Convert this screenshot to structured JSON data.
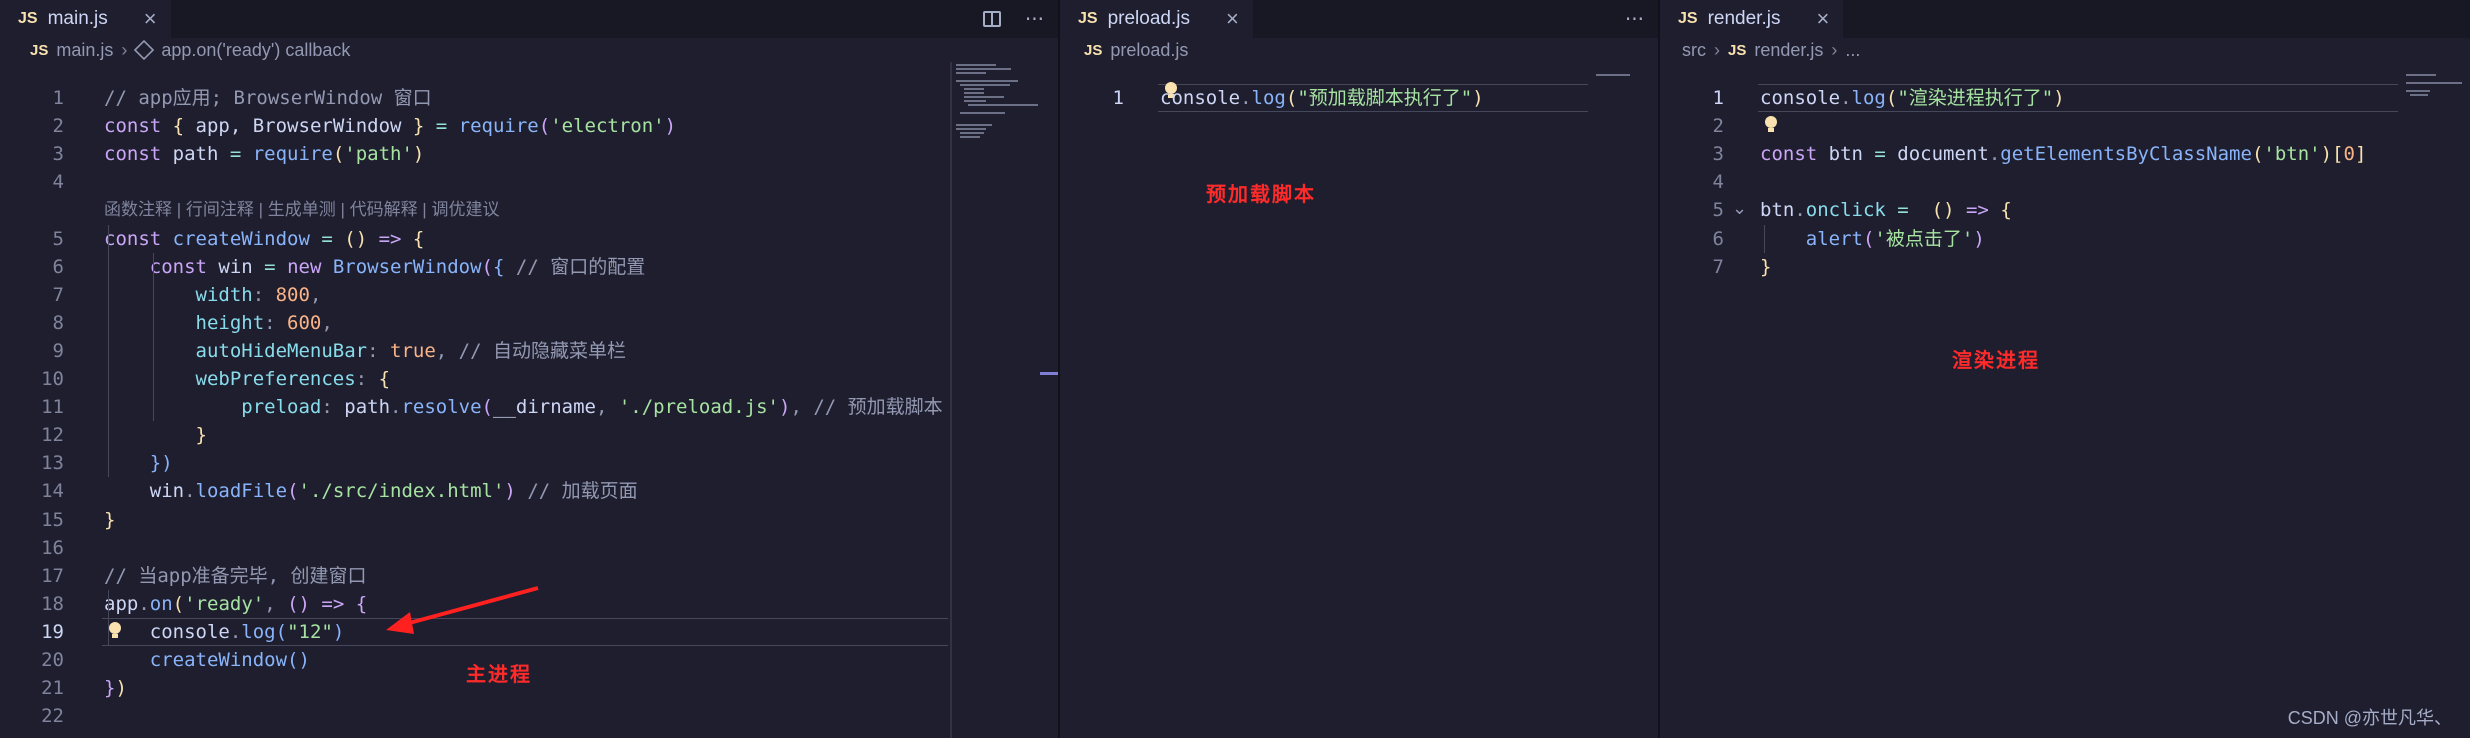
{
  "panes": {
    "main": {
      "tab": {
        "badge": "JS",
        "name": "main.js"
      },
      "breadcrumb": {
        "badge": "JS",
        "file": "main.js",
        "symbol": "app.on('ready') callback"
      },
      "codelens": "函数注释 | 行间注释 | 生成单测 | 代码解释 | 调优建议",
      "lines": [
        {
          "n": "1",
          "tokens": [
            [
              "cm",
              "// app应用; BrowserWindow 窗口"
            ]
          ]
        },
        {
          "n": "2",
          "tokens": [
            [
              "kw",
              "const"
            ],
            [
              "var",
              " "
            ],
            [
              "brk",
              "{"
            ],
            [
              "var",
              " app, BrowserWindow "
            ],
            [
              "brk",
              "}"
            ],
            [
              "op",
              " = "
            ],
            [
              "fn",
              "require"
            ],
            [
              "brk2",
              "("
            ],
            [
              "str",
              "'electron'"
            ],
            [
              "brk2",
              ")"
            ]
          ]
        },
        {
          "n": "3",
          "tokens": [
            [
              "kw",
              "const"
            ],
            [
              "var",
              " path "
            ],
            [
              "op",
              "= "
            ],
            [
              "fn",
              "require"
            ],
            [
              "brk",
              "("
            ],
            [
              "str",
              "'path'"
            ],
            [
              "brk",
              ")"
            ]
          ]
        },
        {
          "n": "4",
          "tokens": []
        },
        {
          "n": "5",
          "tokens": [
            [
              "kw",
              "const"
            ],
            [
              "fn",
              " createWindow"
            ],
            [
              "op",
              " = "
            ],
            [
              "brk",
              "()"
            ],
            [
              "kw",
              " =>"
            ],
            [
              "var",
              " "
            ],
            [
              "brk",
              "{"
            ]
          ]
        },
        {
          "n": "6",
          "tokens": [
            [
              "var",
              "    "
            ],
            [
              "kw",
              "const"
            ],
            [
              "var",
              " win "
            ],
            [
              "op",
              "= "
            ],
            [
              "kw",
              "new"
            ],
            [
              "fn",
              " BrowserWindow"
            ],
            [
              "brk2",
              "("
            ],
            [
              "brk3",
              "{"
            ],
            [
              "cm",
              " // 窗口的配置"
            ]
          ]
        },
        {
          "n": "7",
          "tokens": [
            [
              "var",
              "        "
            ],
            [
              "prop",
              "width"
            ],
            [
              "pun",
              ": "
            ],
            [
              "num",
              "800"
            ],
            [
              "pun",
              ","
            ]
          ]
        },
        {
          "n": "8",
          "tokens": [
            [
              "var",
              "        "
            ],
            [
              "prop",
              "height"
            ],
            [
              "pun",
              ": "
            ],
            [
              "num",
              "600"
            ],
            [
              "pun",
              ","
            ]
          ]
        },
        {
          "n": "9",
          "tokens": [
            [
              "var",
              "        "
            ],
            [
              "prop",
              "autoHideMenuBar"
            ],
            [
              "pun",
              ": "
            ],
            [
              "num",
              "true"
            ],
            [
              "pun",
              ","
            ],
            [
              "cm",
              " // 自动隐藏菜单栏"
            ]
          ]
        },
        {
          "n": "10",
          "tokens": [
            [
              "var",
              "        "
            ],
            [
              "prop",
              "webPreferences"
            ],
            [
              "pun",
              ": "
            ],
            [
              "brk",
              "{"
            ]
          ]
        },
        {
          "n": "11",
          "tokens": [
            [
              "var",
              "            "
            ],
            [
              "prop",
              "preload"
            ],
            [
              "pun",
              ": "
            ],
            [
              "var",
              "path"
            ],
            [
              "pun",
              "."
            ],
            [
              "fn",
              "resolve"
            ],
            [
              "brk2",
              "("
            ],
            [
              "var",
              "__dirname"
            ],
            [
              "pun",
              ", "
            ],
            [
              "str",
              "'./preload.js'"
            ],
            [
              "brk2",
              ")"
            ],
            [
              "pun",
              ","
            ],
            [
              "cm",
              " // 预加载脚本"
            ]
          ]
        },
        {
          "n": "12",
          "tokens": [
            [
              "var",
              "        "
            ],
            [
              "brk",
              "}"
            ]
          ]
        },
        {
          "n": "13",
          "tokens": [
            [
              "var",
              "    "
            ],
            [
              "brk3",
              "})"
            ]
          ]
        },
        {
          "n": "14",
          "tokens": [
            [
              "var",
              "    "
            ],
            [
              "var",
              "win"
            ],
            [
              "pun",
              "."
            ],
            [
              "fn",
              "loadFile"
            ],
            [
              "brk2",
              "("
            ],
            [
              "str",
              "'./src/index.html'"
            ],
            [
              "brk2",
              ")"
            ],
            [
              "cm",
              " // 加载页面"
            ]
          ]
        },
        {
          "n": "15",
          "tokens": [
            [
              "brk",
              "}"
            ]
          ]
        },
        {
          "n": "16",
          "tokens": []
        },
        {
          "n": "17",
          "tokens": [
            [
              "cm",
              "// 当app准备完毕, 创建窗口"
            ]
          ]
        },
        {
          "n": "18",
          "tokens": [
            [
              "var",
              "app"
            ],
            [
              "pun",
              "."
            ],
            [
              "fn",
              "on"
            ],
            [
              "brk",
              "("
            ],
            [
              "str",
              "'ready'"
            ],
            [
              "pun",
              ", "
            ],
            [
              "brk2",
              "()"
            ],
            [
              "kw",
              " =>"
            ],
            [
              "var",
              " "
            ],
            [
              "brk2",
              "{"
            ]
          ]
        },
        {
          "n": "19",
          "tokens": [
            [
              "var",
              "    "
            ],
            [
              "var",
              "console"
            ],
            [
              "pun",
              "."
            ],
            [
              "fn",
              "log"
            ],
            [
              "brk3",
              "("
            ],
            [
              "str",
              "\"12\""
            ],
            [
              "brk3",
              ")"
            ]
          ]
        },
        {
          "n": "20",
          "tokens": [
            [
              "var",
              "    "
            ],
            [
              "fn",
              "createWindow"
            ],
            [
              "brk3",
              "()"
            ]
          ]
        },
        {
          "n": "21",
          "tokens": [
            [
              "brk2",
              "}"
            ],
            [
              "brk",
              ")"
            ]
          ]
        },
        {
          "n": "22",
          "tokens": []
        }
      ],
      "annotation": "主进程"
    },
    "preload": {
      "tab": {
        "badge": "JS",
        "name": "preload.js"
      },
      "breadcrumb": {
        "badge": "JS",
        "file": "preload.js"
      },
      "lines": [
        {
          "n": "1",
          "tokens": [
            [
              "var",
              "console"
            ],
            [
              "pun",
              "."
            ],
            [
              "fn",
              "log"
            ],
            [
              "brk",
              "("
            ],
            [
              "str",
              "\"预加载脚本执行了\""
            ],
            [
              "brk",
              ")"
            ]
          ]
        }
      ],
      "annotation": "预加载脚本"
    },
    "render": {
      "tab": {
        "badge": "JS",
        "name": "render.js"
      },
      "breadcrumb": {
        "folder": "src",
        "badge": "JS",
        "file": "render.js",
        "rest": "..."
      },
      "lines": [
        {
          "n": "1",
          "tokens": [
            [
              "var",
              "console"
            ],
            [
              "pun",
              "."
            ],
            [
              "fn",
              "log"
            ],
            [
              "brk",
              "("
            ],
            [
              "str",
              "\"渲染进程执行了\""
            ],
            [
              "brk",
              ")"
            ]
          ]
        },
        {
          "n": "2",
          "tokens": []
        },
        {
          "n": "3",
          "tokens": [
            [
              "kw",
              "const"
            ],
            [
              "var",
              " btn "
            ],
            [
              "op",
              "= "
            ],
            [
              "var",
              "document"
            ],
            [
              "pun",
              "."
            ],
            [
              "fn",
              "getElementsByClassName"
            ],
            [
              "brk",
              "("
            ],
            [
              "str",
              "'btn'"
            ],
            [
              "brk",
              ")"
            ],
            [
              "brk",
              "["
            ],
            [
              "num",
              "0"
            ],
            [
              "brk",
              "]"
            ]
          ]
        },
        {
          "n": "4",
          "tokens": []
        },
        {
          "n": "5",
          "tokens": [
            [
              "var",
              "btn"
            ],
            [
              "pun",
              "."
            ],
            [
              "prop",
              "onclick"
            ],
            [
              "op",
              " = "
            ],
            [
              "var",
              " "
            ],
            [
              "brk",
              "()"
            ],
            [
              "kw",
              " =>"
            ],
            [
              "var",
              " "
            ],
            [
              "brk",
              "{"
            ]
          ]
        },
        {
          "n": "6",
          "tokens": [
            [
              "var",
              "    "
            ],
            [
              "fn",
              "alert"
            ],
            [
              "brk2",
              "("
            ],
            [
              "str",
              "'被点击了'"
            ],
            [
              "brk2",
              ")"
            ]
          ]
        },
        {
          "n": "7",
          "tokens": [
            [
              "brk",
              "}"
            ]
          ]
        }
      ],
      "annotation": "渲染进程"
    }
  },
  "watermark": "CSDN @亦世凡华、",
  "icons": {
    "split": "split-editor-icon",
    "more": "more-actions-icon",
    "close": "close-icon",
    "symbol": "symbol-method-icon",
    "bulb": "lightbulb-icon",
    "fold": "chevron-down-icon"
  },
  "colors": {
    "background": "#1e1e2e",
    "annotation": "#ff2a2a",
    "js_badge": "#f9e2af"
  }
}
